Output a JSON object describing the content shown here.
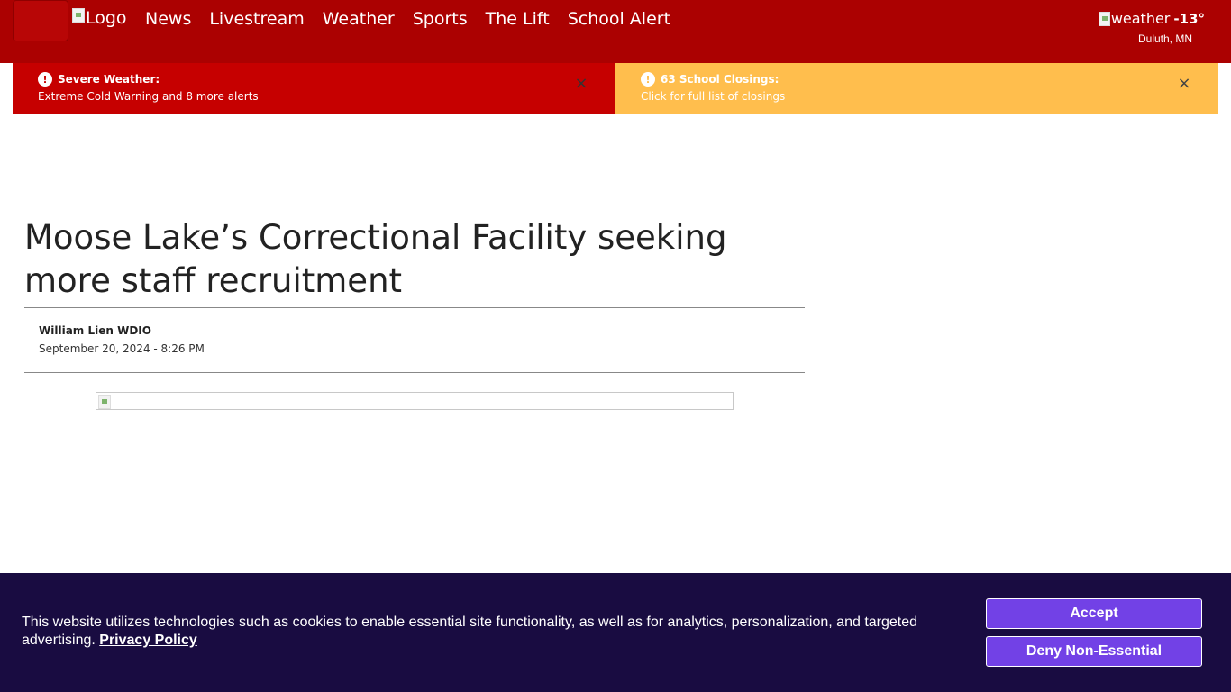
{
  "header": {
    "logo_alt": "Logo",
    "nav": [
      "News",
      "Livestream",
      "Weather",
      "Sports",
      "The Lift",
      "School Alert"
    ],
    "weather": {
      "icon_alt": "weather",
      "temp": "-13°",
      "location": "Duluth, MN"
    }
  },
  "alerts": {
    "severe": {
      "title": "Severe Weather:",
      "text": "Extreme Cold Warning and 8 more alerts",
      "close": "×"
    },
    "school": {
      "title": "63 School Closings:",
      "text": "Click for full list of closings",
      "close": "×"
    }
  },
  "article": {
    "headline": "Moose Lake’s Correctional Facility seeking more staff recruitment",
    "author": "William Lien WDIO",
    "date": "September 20, 2024 - 8:26 PM"
  },
  "cookie": {
    "text": "This website utilizes technologies such as cookies to enable essential site functionality, as well as for analytics, personalization, and targeted advertising.",
    "policy_link": "Privacy Policy",
    "accept": "Accept",
    "deny": "Deny Non-Essential"
  },
  "colors": {
    "header_bg": "#ab0101",
    "alert_red": "#c60000",
    "alert_yellow": "#ffbe4d",
    "cookie_bg": "#190c41",
    "button": "#7241e6"
  }
}
